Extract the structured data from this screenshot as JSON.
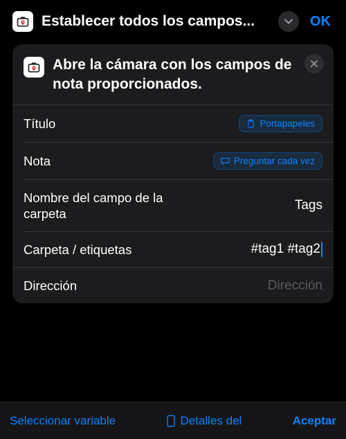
{
  "header": {
    "title": "Establecer todos los campos...",
    "ok": "OK"
  },
  "card": {
    "description": "Abre la cámara con los campos de nota proporcionados."
  },
  "rows": {
    "title": {
      "label": "Título",
      "chip": "Portapapeles"
    },
    "note": {
      "label": "Nota",
      "chip": "Preguntar cada vez"
    },
    "folderField": {
      "label": "Nombre del campo de la carpeta",
      "value": "Tags"
    },
    "folderTags": {
      "label": "Carpeta / etiquetas",
      "value": "#tag1 #tag2"
    },
    "address": {
      "label": "Dirección",
      "placeholder": "Dirección"
    }
  },
  "bottom": {
    "selectVar": "Seleccionar variable",
    "details": "Detalles del",
    "accept": "Aceptar"
  }
}
